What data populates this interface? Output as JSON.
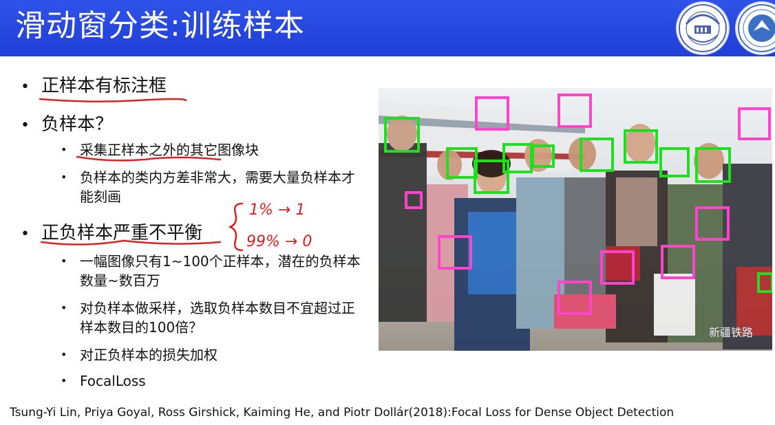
{
  "title": "滑动窗分类:训练样本",
  "logos": {
    "left": "ANHUI UNIVERSITY",
    "left_year": "1928"
  },
  "bullets": [
    {
      "level": 1,
      "text": "正样本有标注框"
    },
    {
      "level": 1,
      "text": "负样本？"
    },
    {
      "level": 2,
      "text": "采集正样本之外的其它图像块"
    },
    {
      "level": 2,
      "text": "负样本的类内方差非常大，需要大量负样本才能刻画"
    },
    {
      "level": 1,
      "text": "正负样本严重不平衡"
    },
    {
      "level": 2,
      "text": "一幅图像只有1~100个正样本，潜在的负样本数量~数百万"
    },
    {
      "level": 2,
      "text": "对负样本做采样，选取负样本数目不宜超过正样本数目的100倍？"
    },
    {
      "level": 2,
      "text": "对正负样本的损失加权"
    },
    {
      "level": 2,
      "text": "FocalLoss"
    }
  ],
  "handwriting": {
    "line1": "1% → 1",
    "line2": "99% → 0"
  },
  "photo_watermark": "新疆铁路",
  "citation": "Tsung-Yi Lin, Priya Goyal, Ross Girshick, Kaiming He, and Piotr Dollár(2018):Focal Loss for Dense Object Detection",
  "colors": {
    "title_bar": "#2f52e8",
    "positive_box": "#22dd22",
    "negative_box": "#ff44cc",
    "ink": "#e02020"
  }
}
